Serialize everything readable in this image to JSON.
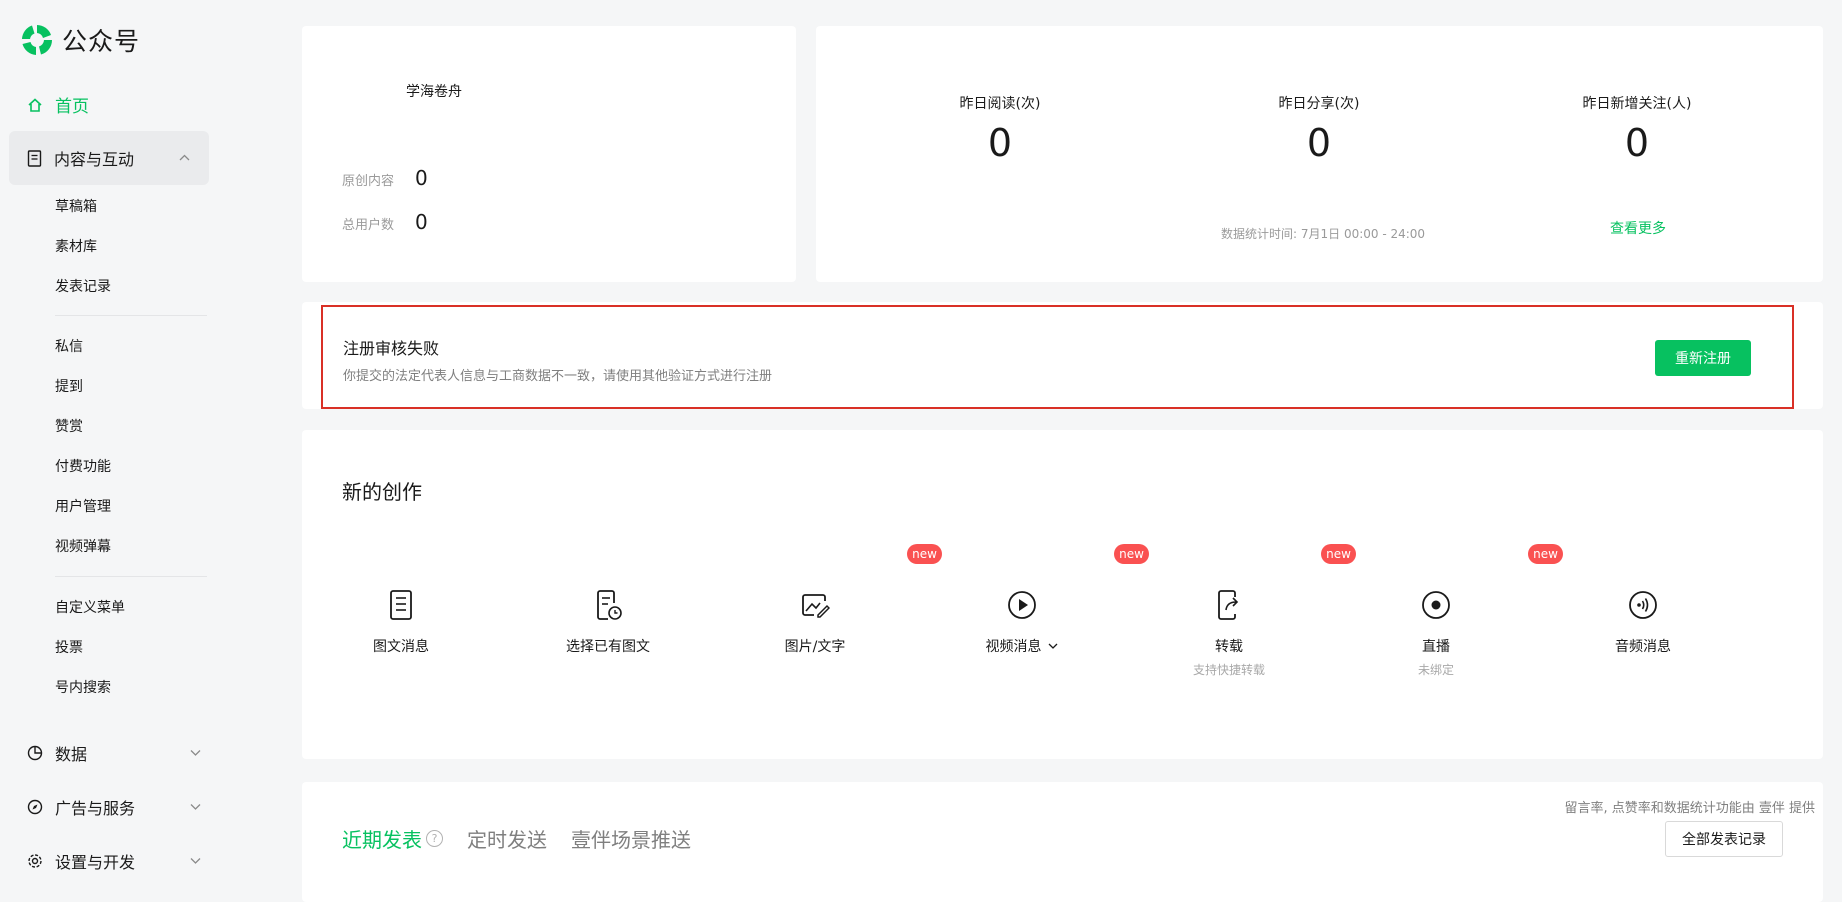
{
  "app": {
    "logo_text": "公众号"
  },
  "sidebar": {
    "home": "首页",
    "content_group": "内容与互动",
    "content_items_a": [
      "草稿箱",
      "素材库",
      "发表记录"
    ],
    "content_items_b": [
      "私信",
      "提到",
      "赞赏",
      "付费功能",
      "用户管理",
      "视频弹幕"
    ],
    "content_items_c": [
      "自定义菜单",
      "投票",
      "号内搜索"
    ],
    "data_group": "数据",
    "ads_group": "广告与服务",
    "settings_group": "设置与开发"
  },
  "account": {
    "name": "学海卷舟",
    "original_label": "原创内容",
    "original_value": "0",
    "users_label": "总用户数",
    "users_value": "0"
  },
  "stats": {
    "reads_label": "昨日阅读(次)",
    "reads_value": "0",
    "shares_label": "昨日分享(次)",
    "shares_value": "0",
    "follows_label": "昨日新增关注(人)",
    "follows_value": "0",
    "time_note": "数据统计时间: 7月1日 00:00 - 24:00",
    "more_link": "查看更多"
  },
  "alert": {
    "title": "注册审核失败",
    "desc": "你提交的法定代表人信息与工商数据不一致，请使用其他验证方式进行注册",
    "button": "重新注册"
  },
  "create": {
    "title": "新的创作",
    "badge": "new",
    "tools": [
      {
        "label": "图文消息",
        "sub": ""
      },
      {
        "label": "选择已有图文",
        "sub": ""
      },
      {
        "label": "图片/文字",
        "sub": ""
      },
      {
        "label": "视频消息",
        "sub": ""
      },
      {
        "label": "转载",
        "sub": "支持快捷转载"
      },
      {
        "label": "直播",
        "sub": "未绑定"
      },
      {
        "label": "音频消息",
        "sub": ""
      }
    ]
  },
  "recent": {
    "tabs": [
      "近期发表",
      "定时发送",
      "壹伴场景推送"
    ],
    "note": "留言率, 点赞率和数据统计功能由 壹伴 提供",
    "all_button": "全部发表记录"
  },
  "colors": {
    "accent": "#07c160",
    "alert_border": "#d93026",
    "badge": "#fa5151"
  }
}
